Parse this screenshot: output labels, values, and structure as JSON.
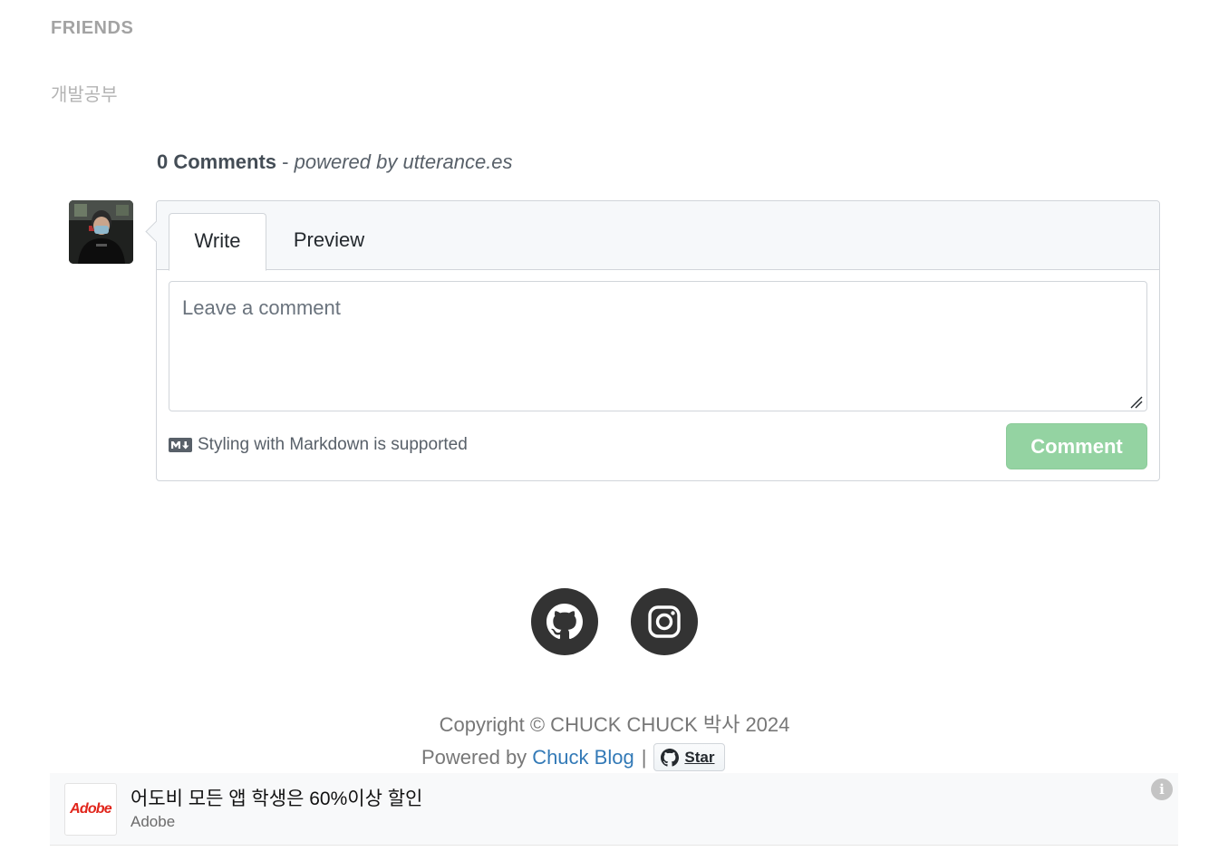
{
  "sidebar": {
    "section_title": "FRIENDS",
    "friends": [
      {
        "label": "개발공부"
      }
    ]
  },
  "comments": {
    "count_label": "0 Comments",
    "separator": " - ",
    "powered_label": "powered by utterance.es",
    "tabs": [
      {
        "label": "Write",
        "active": true
      },
      {
        "label": "Preview",
        "active": false
      }
    ],
    "textarea": {
      "placeholder": "Leave a comment",
      "value": ""
    },
    "markdown_hint": "Styling with Markdown is supported",
    "submit_label": "Comment",
    "submit_color": "#94d3a2"
  },
  "footer": {
    "social": [
      {
        "name": "github",
        "icon": "github-icon"
      },
      {
        "name": "instagram",
        "icon": "instagram-icon"
      }
    ],
    "copyright": "Copyright © CHUCK CHUCK 박사 2024",
    "powered_prefix": "Powered by",
    "blog_link": "Chuck Blog",
    "pipe": "|",
    "star_label": "Star",
    "link_color": "#337ab7"
  },
  "ad": {
    "logo_text": "Adobe",
    "title": "어도비 모든 앱 학생은 60%이상 할인",
    "advertiser": "Adobe",
    "info_icon": "i",
    "brand_color": "#e1251b"
  }
}
